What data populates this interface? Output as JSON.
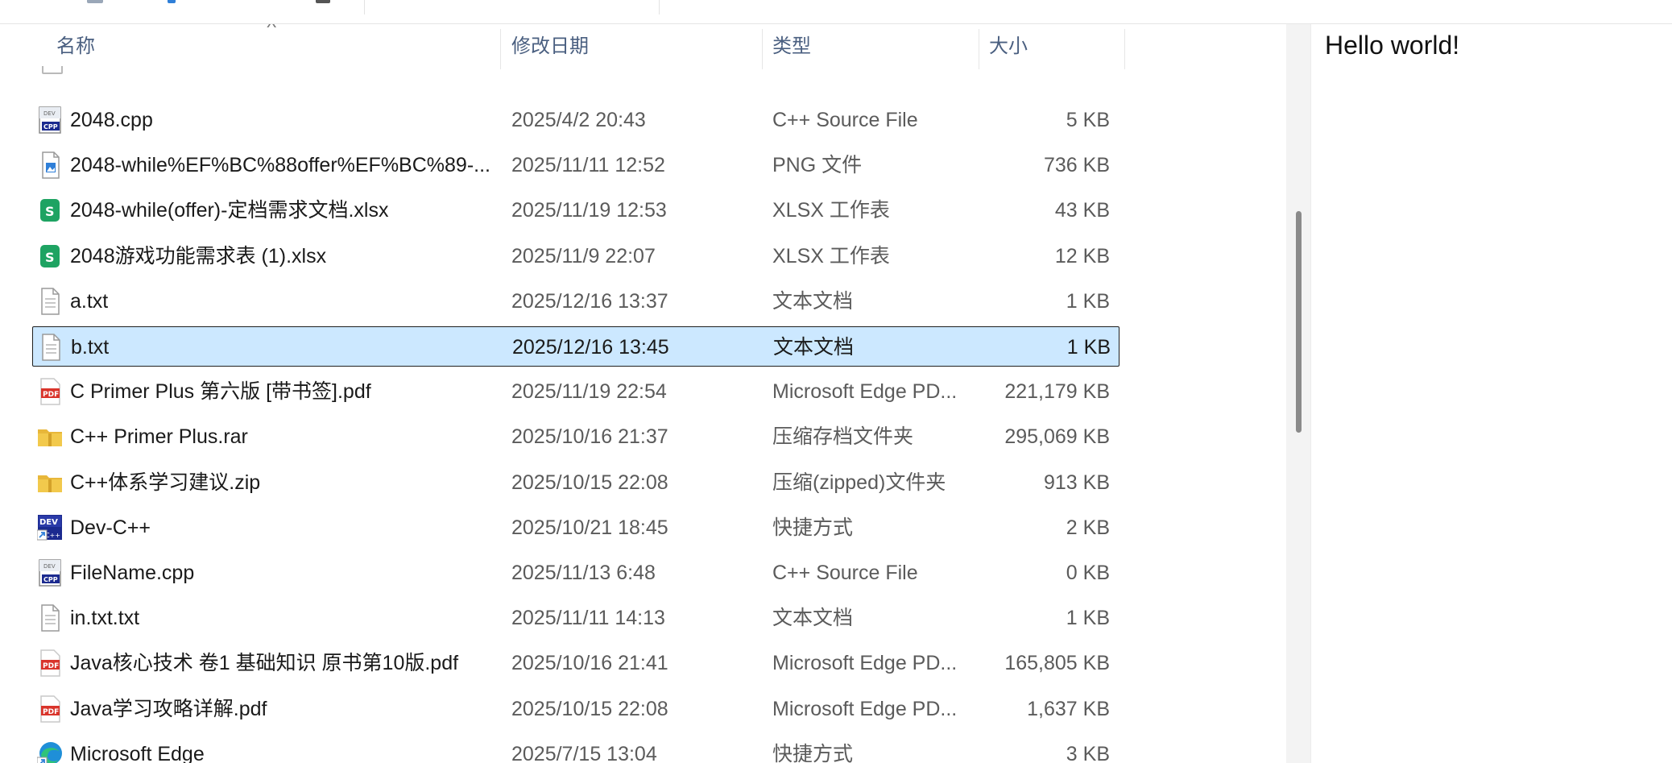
{
  "columns": {
    "name": "名称",
    "modified": "修改日期",
    "type": "类型",
    "size": "大小"
  },
  "files": [
    {
      "name": "2048.cpp",
      "modified": "2025/4/2 20:43",
      "type": "C++ Source File",
      "size": "5 KB",
      "icon": "cpp-file-icon",
      "selected": false
    },
    {
      "name": "2048-while%EF%BC%88offer%EF%BC%89-...",
      "modified": "2025/11/11 12:52",
      "type": "PNG 文件",
      "size": "736 KB",
      "icon": "image-file-icon",
      "selected": false
    },
    {
      "name": "2048-while(offer)-定档需求文档.xlsx",
      "modified": "2025/11/19 12:53",
      "type": "XLSX 工作表",
      "size": "43 KB",
      "icon": "spreadsheet-icon",
      "selected": false
    },
    {
      "name": "2048游戏功能需求表 (1).xlsx",
      "modified": "2025/11/9 22:07",
      "type": "XLSX 工作表",
      "size": "12 KB",
      "icon": "spreadsheet-icon",
      "selected": false
    },
    {
      "name": "a.txt",
      "modified": "2025/12/16 13:37",
      "type": "文本文档",
      "size": "1 KB",
      "icon": "text-file-icon",
      "selected": false
    },
    {
      "name": "b.txt",
      "modified": "2025/12/16 13:45",
      "type": "文本文档",
      "size": "1 KB",
      "icon": "text-file-icon",
      "selected": true
    },
    {
      "name": "C Primer Plus 第六版 [带书签].pdf",
      "modified": "2025/11/19 22:54",
      "type": "Microsoft Edge PD...",
      "size": "221,179 KB",
      "icon": "pdf-file-icon",
      "selected": false
    },
    {
      "name": "C++ Primer Plus.rar",
      "modified": "2025/10/16 21:37",
      "type": "压缩存档文件夹",
      "size": "295,069 KB",
      "icon": "archive-folder-icon",
      "selected": false
    },
    {
      "name": "C++体系学习建议.zip",
      "modified": "2025/10/15 22:08",
      "type": "压缩(zipped)文件夹",
      "size": "913 KB",
      "icon": "archive-folder-icon",
      "selected": false
    },
    {
      "name": "Dev-C++",
      "modified": "2025/10/21 18:45",
      "type": "快捷方式",
      "size": "2 KB",
      "icon": "devcpp-shortcut-icon",
      "selected": false
    },
    {
      "name": "FileName.cpp",
      "modified": "2025/11/13 6:48",
      "type": "C++ Source File",
      "size": "0 KB",
      "icon": "cpp-file-icon",
      "selected": false
    },
    {
      "name": "in.txt.txt",
      "modified": "2025/11/11 14:13",
      "type": "文本文档",
      "size": "1 KB",
      "icon": "text-file-icon",
      "selected": false
    },
    {
      "name": "Java核心技术 卷1 基础知识 原书第10版.pdf",
      "modified": "2025/10/16 21:41",
      "type": "Microsoft Edge PD...",
      "size": "165,805 KB",
      "icon": "pdf-file-icon",
      "selected": false
    },
    {
      "name": "Java学习攻略详解.pdf",
      "modified": "2025/10/15 22:08",
      "type": "Microsoft Edge PD...",
      "size": "1,637 KB",
      "icon": "pdf-file-icon",
      "selected": false
    },
    {
      "name": "Microsoft Edge",
      "modified": "2025/7/15 13:04",
      "type": "快捷方式",
      "size": "3 KB",
      "icon": "edge-shortcut-icon",
      "selected": false
    }
  ],
  "preview": {
    "text": "Hello world!"
  },
  "colors": {
    "selection": "#cce8ff",
    "header_text": "#4a5f80",
    "pdf": "#d9342b",
    "spreadsheet": "#1ea362",
    "folder": "#f2c94c"
  }
}
